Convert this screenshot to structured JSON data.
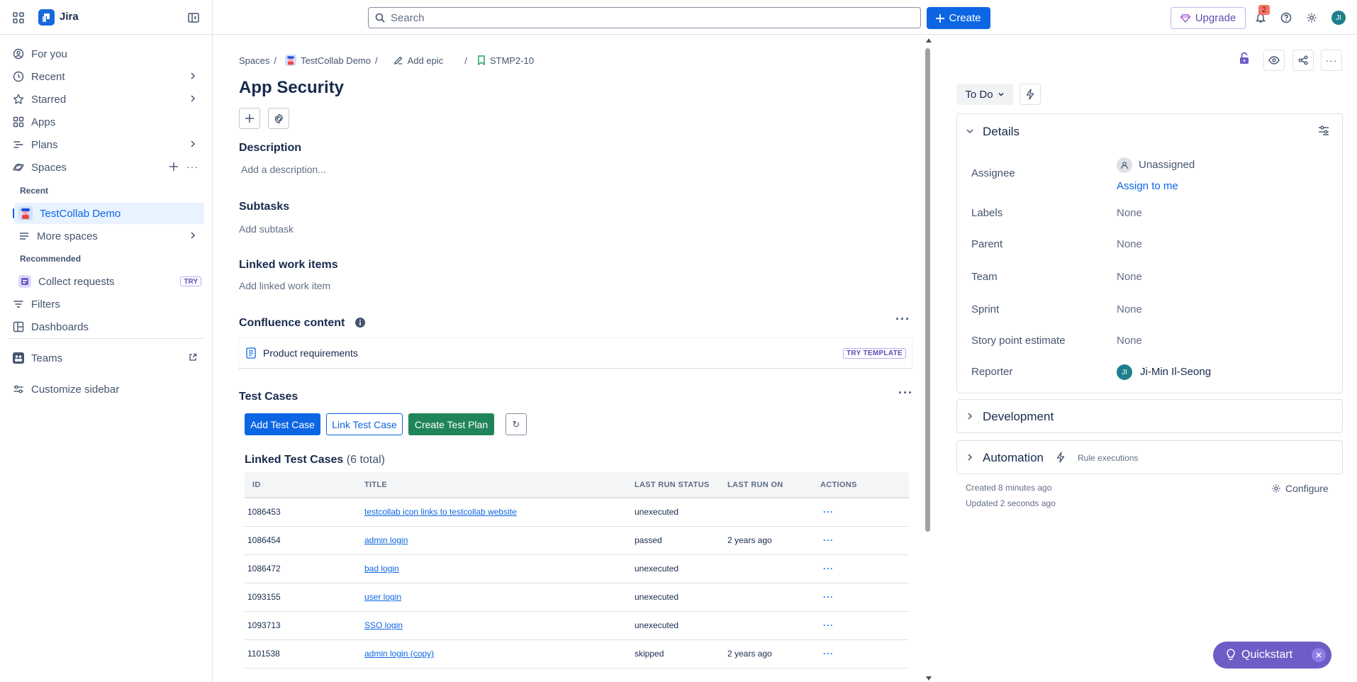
{
  "app": {
    "name": "Jira",
    "search_placeholder": "Search",
    "create_label": "Create",
    "upgrade_label": "Upgrade",
    "notification_count": "2",
    "user_initials": "JI"
  },
  "sidebar": {
    "items": [
      {
        "label": "For you"
      },
      {
        "label": "Recent"
      },
      {
        "label": "Starred"
      },
      {
        "label": "Apps"
      },
      {
        "label": "Plans"
      },
      {
        "label": "Spaces"
      }
    ],
    "recent_header": "Recent",
    "recent_space": "TestCollab Demo",
    "more_spaces": "More spaces",
    "recommended_header": "Recommended",
    "collect_requests": "Collect requests",
    "try_badge": "TRY",
    "filters": "Filters",
    "dashboards": "Dashboards",
    "teams": "Teams",
    "customize": "Customize sidebar"
  },
  "breadcrumb": {
    "spaces": "Spaces",
    "project": "TestCollab Demo",
    "add_epic": "Add epic",
    "issue_key": "STMP2-10",
    "sep": "/"
  },
  "issue": {
    "title": "App Security",
    "description_header": "Description",
    "description_placeholder": "Add a description...",
    "subtasks_header": "Subtasks",
    "subtasks_placeholder": "Add subtask",
    "linked_header": "Linked work items",
    "linked_placeholder": "Add linked work item",
    "confluence_header": "Confluence content",
    "confluence_item": "Product requirements",
    "try_template": "TRY TEMPLATE"
  },
  "test_cases": {
    "header": "Test Cases",
    "add_label": "Add Test Case",
    "link_label": "Link Test Case",
    "create_plan_label": "Create Test Plan",
    "refresh_symbol": "↻",
    "linked_title": "Linked Test Cases",
    "linked_total": "(6 total)",
    "columns": [
      "ID",
      "TITLE",
      "LAST RUN STATUS",
      "LAST RUN ON",
      "ACTIONS"
    ],
    "rows": [
      {
        "id": "1086453",
        "title": "testcollab icon links to testcollab website",
        "status": "unexecuted",
        "last_run": ""
      },
      {
        "id": "1086454",
        "title": "admin login",
        "status": "passed",
        "last_run": "2 years ago"
      },
      {
        "id": "1086472",
        "title": "bad login",
        "status": "unexecuted",
        "last_run": ""
      },
      {
        "id": "1093155",
        "title": "user login",
        "status": "unexecuted",
        "last_run": ""
      },
      {
        "id": "1093713",
        "title": "SSO login",
        "status": "unexecuted",
        "last_run": ""
      },
      {
        "id": "1101538",
        "title": "admin login (copy)",
        "status": "skipped",
        "last_run": "2 years ago"
      }
    ],
    "action_symbol": "···"
  },
  "details": {
    "status": "To Do",
    "header": "Details",
    "assignee_label": "Assignee",
    "assignee_value": "Unassigned",
    "assign_to_me": "Assign to me",
    "labels_label": "Labels",
    "labels_value": "None",
    "parent_label": "Parent",
    "parent_value": "None",
    "team_label": "Team",
    "team_value": "None",
    "sprint_label": "Sprint",
    "sprint_value": "None",
    "story_label": "Story point estimate",
    "story_value": "None",
    "reporter_label": "Reporter",
    "reporter_value": "Ji-Min Il-Seong",
    "reporter_initials": "JI"
  },
  "development": {
    "header": "Development"
  },
  "automation": {
    "header": "Automation",
    "rule_executions": "Rule executions"
  },
  "meta": {
    "created": "Created 8 minutes ago",
    "updated": "Updated 2 seconds ago",
    "configure": "Configure"
  },
  "quickstart": {
    "label": "Quickstart"
  },
  "colors": {
    "accent": "#0c66e4",
    "green_button": "#1f845a",
    "quickstart": "#6e5dc6"
  }
}
